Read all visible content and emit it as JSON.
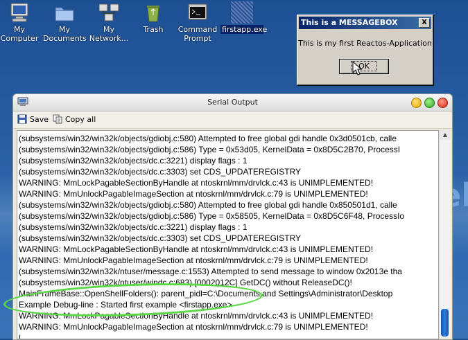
{
  "desktop": {
    "icons": [
      {
        "label": "My\nComputer",
        "icon": "computer-icon"
      },
      {
        "label": "My\nDocuments",
        "icon": "documents-folder-icon"
      },
      {
        "label": "My\nNetwork...",
        "icon": "network-icon"
      },
      {
        "label": "Trash",
        "icon": "trash-icon"
      },
      {
        "label": "Command\nPrompt",
        "icon": "command-prompt-icon"
      },
      {
        "label": "firstapp.exe",
        "icon": "exe-icon",
        "selected": true
      }
    ],
    "background_text": "el"
  },
  "messagebox": {
    "title": "This is a MESSAGEBOX",
    "close_label": "X",
    "text": "This is my first Reactos-Application",
    "ok_label": "OK"
  },
  "serial_window": {
    "title": "Serial Output",
    "toolbar": {
      "save_label": "Save",
      "copy_all_label": "Copy all"
    },
    "log_lines": [
      "(subsystems/win32/win32k/objects/gdiobj.c:580) Attempted to free global gdi handle 0x3d0501cb, calle",
      "(subsystems/win32/win32k/objects/gdiobj.c:586) Type = 0x53d05, KernelData = 0x8D5C2B70, ProcessI",
      "(subsystems/win32/win32k/objects/dc.c:3221) display flags : 1",
      "(subsystems/win32/win32k/objects/dc.c:3303) set CDS_UPDATEREGISTRY",
      "WARNING:  MmLockPagableSectionByHandle at ntoskrnl/mm/drvlck.c:43 is UNIMPLEMENTED!",
      "WARNING:  MmUnlockPagableImageSection at ntoskrnl/mm/drvlck.c:79 is UNIMPLEMENTED!",
      "(subsystems/win32/win32k/objects/gdiobj.c:580) Attempted to free global gdi handle 0x850501d1, calle",
      "(subsystems/win32/win32k/objects/gdiobj.c:586) Type = 0x58505, KernelData = 0x8D5C6F48, ProcessIo",
      "(subsystems/win32/win32k/objects/dc.c:3221) display flags : 1",
      "(subsystems/win32/win32k/objects/dc.c:3303) set CDS_UPDATEREGISTRY",
      "WARNING:  MmLockPagableSectionByHandle at ntoskrnl/mm/drvlck.c:43 is UNIMPLEMENTED!",
      "WARNING:  MmUnlockPagableImageSection at ntoskrnl/mm/drvlck.c:79 is UNIMPLEMENTED!",
      "(subsystems/win32/win32k/ntuser/message.c:1553) Attempted to send message to window 0x2013e tha",
      "(subsystems/win32/win32k/ntuser/windc.c:683) [0002012C] GetDC() without ReleaseDC()!",
      "MainFrameBase::OpenShellFolders(): parent_pidl=C:\\Documents and Settings\\Administrator\\Desktop",
      "Example Debug-line : Started first example <firstapp.exe>",
      "WARNING:  MmLockPagableSectionByHandle at ntoskrnl/mm/drvlck.c:43 is UNIMPLEMENTED!",
      "WARNING:  MmUnlockPagableImageSection at ntoskrnl/mm/drvlck.c:79 is UNIMPLEMENTED!",
      "|"
    ]
  }
}
